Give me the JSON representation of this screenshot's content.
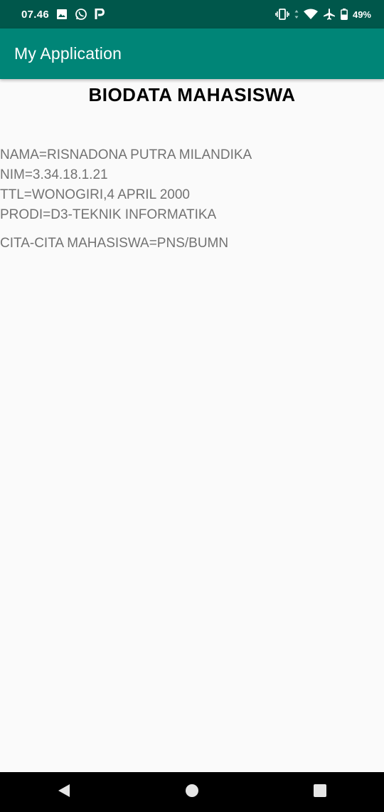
{
  "status_bar": {
    "time": "07.46",
    "battery": "49%",
    "icons_left": [
      "image-icon",
      "whatsapp-icon",
      "parking-icon"
    ],
    "icons_right": [
      "vibrate-icon",
      "data-arrows-icon",
      "wifi-icon",
      "airplane-icon",
      "battery-icon"
    ]
  },
  "app_bar": {
    "title": "My Application",
    "color": "#008577",
    "status_color": "#00574b"
  },
  "content": {
    "heading": "BIODATA MAHASISWA",
    "info": [
      "NAMA=RISNADONA PUTRA MILANDIKA",
      "NIM=3.34.18.1.21",
      "TTL=WONOGIRI,4 APRIL 2000",
      "PRODI=D3-TEKNIK INFORMATIKA"
    ],
    "aspiration": "CITA-CITA MAHASISWA=PNS/BUMN",
    "text_color": "#737373"
  },
  "nav_bar": {
    "buttons": [
      "back-icon",
      "home-icon",
      "recents-icon"
    ]
  }
}
